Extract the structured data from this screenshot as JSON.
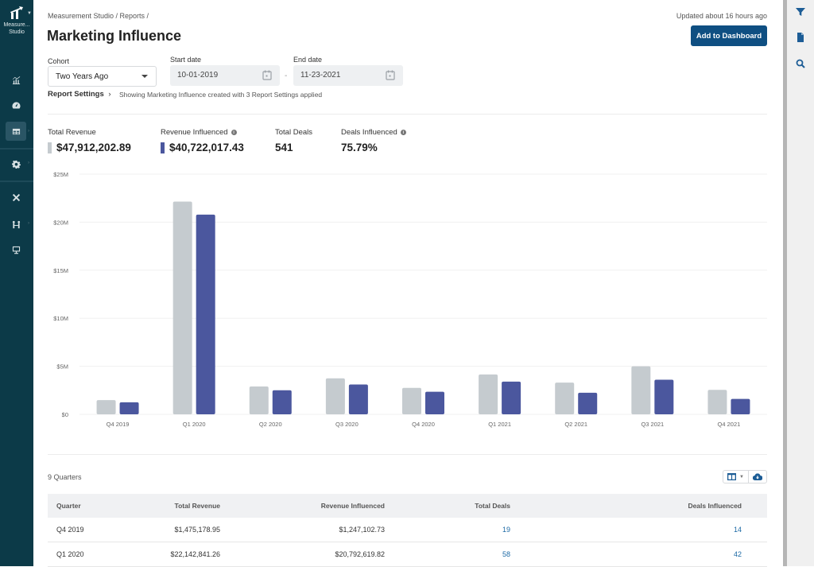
{
  "sidebar": {
    "app_name": "Measure... Studio",
    "items": [
      {
        "name": "analytics",
        "icon": "chart-line-icon",
        "active": false,
        "has_submenu": false
      },
      {
        "name": "dashboard",
        "icon": "gauge-icon",
        "active": false,
        "has_submenu": false
      },
      {
        "name": "reports",
        "icon": "table-icon",
        "active": true,
        "has_submenu": true
      },
      {
        "name": "settings",
        "icon": "gear-icon",
        "active": false,
        "has_submenu": true
      },
      {
        "name": "tools",
        "icon": "tools-icon",
        "active": false,
        "has_submenu": false
      },
      {
        "name": "connections",
        "icon": "connection-icon",
        "active": false,
        "has_submenu": true
      },
      {
        "name": "presentation",
        "icon": "monitor-icon",
        "active": false,
        "has_submenu": false
      }
    ]
  },
  "header": {
    "breadcrumb": "Measurement Studio / Reports /",
    "title": "Marketing Influence",
    "updated": "Updated about 16 hours ago",
    "add_button": "Add to Dashboard"
  },
  "filters": {
    "cohort_label": "Cohort",
    "cohort_value": "Two Years Ago",
    "start_label": "Start date",
    "start_value": "10-01-2019",
    "end_label": "End date",
    "end_value": "11-23-2021",
    "separator": "-",
    "report_settings": "Report Settings",
    "report_note": "Showing Marketing Influence created with 3 Report Settings applied"
  },
  "kpis": [
    {
      "label": "Total Revenue",
      "value": "$47,912,202.89",
      "swatch": "#c5cbcf",
      "info": false
    },
    {
      "label": "Revenue Influenced",
      "value": "$40,722,017.43",
      "swatch": "#4b579e",
      "info": true
    },
    {
      "label": "Total Deals",
      "value": "541",
      "info": false
    },
    {
      "label": "Deals Influenced",
      "value": "75.79%",
      "info": true
    }
  ],
  "colors": {
    "total": "#c5cbcf",
    "influenced": "#4b579e",
    "accent": "#0f4f82",
    "sidebar": "#0c3a48"
  },
  "chart_data": {
    "type": "bar",
    "title": "",
    "xlabel": "",
    "ylabel": "",
    "ylim": [
      0,
      25000000
    ],
    "yticks": [
      0,
      5000000,
      10000000,
      15000000,
      20000000,
      25000000
    ],
    "ytick_labels": [
      "$0",
      "$5M",
      "$10M",
      "$15M",
      "$20M",
      "$25M"
    ],
    "grid": true,
    "categories": [
      "Q4 2019",
      "Q1 2020",
      "Q2 2020",
      "Q3 2020",
      "Q4 2020",
      "Q1 2021",
      "Q2 2021",
      "Q3 2021",
      "Q4 2021"
    ],
    "series": [
      {
        "name": "Total Revenue",
        "values": [
          1475178.95,
          22142841.26,
          2900000,
          3750000,
          2750000,
          4150000,
          3300000,
          5000000,
          2550000
        ]
      },
      {
        "name": "Revenue Influenced",
        "values": [
          1247102.73,
          20792619.82,
          2500000,
          3100000,
          2350000,
          3400000,
          2250000,
          3600000,
          1600000
        ]
      }
    ]
  },
  "table": {
    "count_label": "9 Quarters",
    "columns": [
      "Quarter",
      "Total Revenue",
      "Revenue Influenced",
      "Total Deals",
      "Deals Influenced"
    ],
    "rows": [
      [
        "Q4 2019",
        "$1,475,178.95",
        "$1,247,102.73",
        "19",
        "14"
      ],
      [
        "Q1 2020",
        "$22,142,841.26",
        "$20,792,619.82",
        "58",
        "42"
      ]
    ]
  },
  "right_panel": {
    "icons": [
      "filter-icon",
      "document-icon",
      "search-icon"
    ]
  }
}
